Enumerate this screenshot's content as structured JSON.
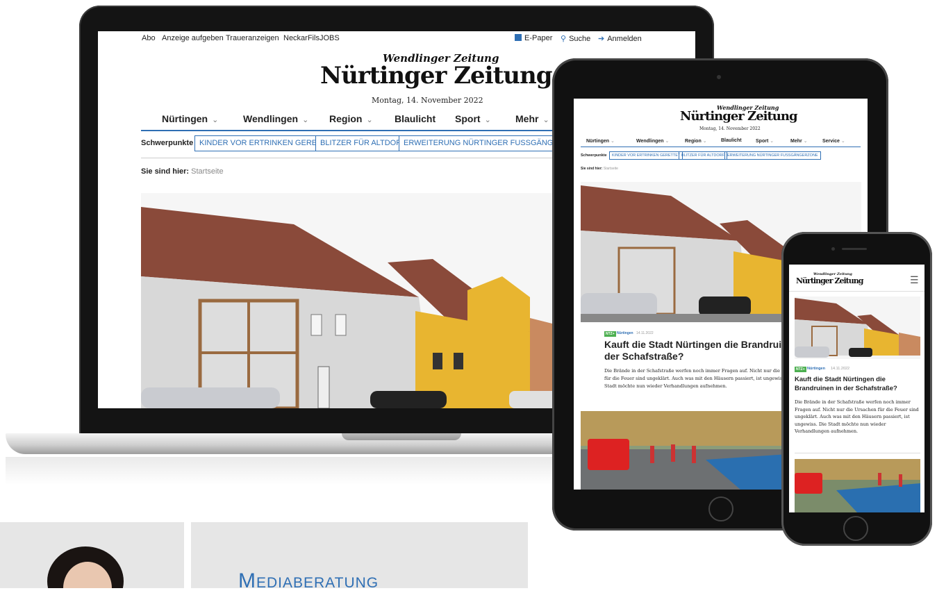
{
  "laptop": {
    "topbar": {
      "links": [
        "Abo",
        "Anzeige aufgeben",
        "Traueranzeigen",
        "NeckarFilsJOBS"
      ],
      "epaper": "E-Paper",
      "search": "Suche",
      "login": "Anmelden"
    },
    "logo": {
      "sub": "Wendlinger Zeitung",
      "main": "Nürtinger Zeitung"
    },
    "date": "Montag, 14. November 2022",
    "nav": [
      "Nürtingen",
      "Wendlingen",
      "Region",
      "Blaulicht",
      "Sport",
      "Mehr"
    ],
    "schwerpunkte_label": "Schwerpunkte",
    "schwerpunkte": [
      "KINDER VOR ERTRINKEN GERETTET",
      "BLITZER FÜR ALTDORF",
      "ERWEITERUNG NÜRTINGER FUSSGÄNGERZONE"
    ],
    "breadcrumb_label": "Sie sind hier:",
    "breadcrumb_current": "Startseite"
  },
  "tablet": {
    "logo": {
      "sub": "Wendlinger Zeitung",
      "main": "Nürtinger Zeitung"
    },
    "date": "Montag, 14. November 2022",
    "nav": [
      "Nürtingen",
      "Wendlingen",
      "Region",
      "Blaulicht",
      "Sport",
      "Mehr",
      "Service"
    ],
    "schwerpunkte_label": "Schwerpunkte",
    "schwerpunkte": [
      "KINDER VOR ERTRINKEN GERETTET",
      "BLITZER FÜR ALTDORF",
      "ERWEITERUNG NÜRTINGER FUSSGÄNGERZONE"
    ],
    "breadcrumb_label": "Sie sind hier:",
    "breadcrumb_current": "Startseite",
    "article": {
      "badge": "NTZ+",
      "category": "Nürtingen",
      "date": "14.11.2022",
      "headline": "Kauft die Stadt Nürtingen die Brandruinen in der Schafstraße?",
      "teaser": "Die Brände in der Schafstraße werfen noch immer Fragen auf. Nicht nur die Ursachen für die Feuer sind ungeklärt. Auch was mit den Häusern passiert, ist ungewiss. Die Stadt möchte nun wieder Verhandlungen aufnehmen."
    }
  },
  "phone": {
    "logo": {
      "sub": "Wendlinger Zeitung",
      "main": "Nürtinger Zeitung"
    },
    "article": {
      "badge": "NTZ+",
      "category": "Nürtingen",
      "date": "14.11.2022",
      "headline": "Kauft die Stadt Nürtingen die Brandruinen in der Schafstraße?",
      "teaser": "Die Brände in der Schafstraße werfen noch immer Fragen auf. Nicht nur die Ursachen für die Feuer sind ungeklärt. Auch was mit den Häusern passiert, ist ungewiss. Die Stadt möchte nun wieder Verhandlungen aufnehmen."
    }
  },
  "bottom": {
    "heading": "Mediaberatung"
  },
  "colors": {
    "accent": "#2f6fb4",
    "badge": "#4caf50",
    "heading": "#2f6fb4"
  }
}
